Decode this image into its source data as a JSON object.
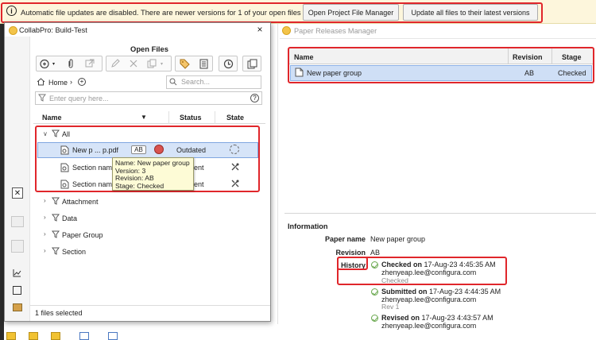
{
  "notification": {
    "text": "Automatic file updates are disabled. There are newer versions for 1 of your open files",
    "open_manager_label": "Open Project File Manager",
    "update_all_label": "Update all files to their latest versions"
  },
  "paper_releases": {
    "title": "Paper Releases Manager",
    "columns": [
      "Name",
      "Revision",
      "Stage"
    ],
    "rows": [
      {
        "name": "New paper group",
        "revision": "AB",
        "stage": "Checked"
      }
    ]
  },
  "information": {
    "title": "Information",
    "paper_name_label": "Paper name",
    "paper_name_value": "New paper group",
    "revision_label": "Revision",
    "revision_value": "AB",
    "history_label": "History",
    "history": [
      {
        "action": "Checked on",
        "date": "17-Aug-23 4:45:35 AM",
        "user": "zhenyeap.lee@configura.com",
        "note": "Checked"
      },
      {
        "action": "Submitted on",
        "date": "17-Aug-23 4:44:35 AM",
        "user": "zhenyeap.lee@configura.com",
        "note": "Rev 1"
      },
      {
        "action": "Revised on",
        "date": "17-Aug-23 4:43:57 AM",
        "user": "zhenyeap.lee@configura.com",
        "note": ""
      }
    ]
  },
  "dialog": {
    "title": "CollabPro: Build-Test",
    "close_label": "×",
    "heading": "Open Files",
    "home_label": "Home",
    "search_placeholder": "Search...",
    "query_placeholder": "Enter query here...",
    "help_label": "?",
    "columns": {
      "name": "Name",
      "status": "Status",
      "state": "State"
    },
    "groups": {
      "all": "All",
      "attachment": "Attachment",
      "data": "Data",
      "paper_group": "Paper Group",
      "section": "Section"
    },
    "files": [
      {
        "name": "New p ... p.pdf",
        "badge": "AB",
        "status": "Outdated"
      },
      {
        "name": "Section nam",
        "status": "ent"
      },
      {
        "name": "Section nam",
        "status": "ent"
      }
    ],
    "tooltip": {
      "line1": "Name: New paper group",
      "line2": "Version: 3",
      "line3": "Revision: AB",
      "line4": "Stage: Checked"
    },
    "status_text": "1 files selected"
  },
  "colors": {
    "highlight": "#e0262b",
    "selection": "#d6e4f8",
    "notification_bg": "#fdf6dc",
    "check_green": "#6aa84f"
  }
}
